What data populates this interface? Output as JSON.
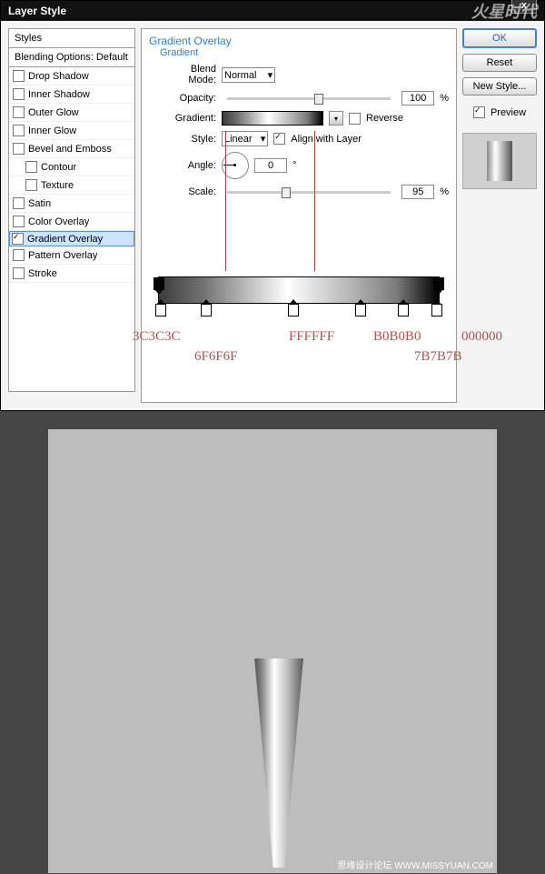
{
  "dialog": {
    "title": "Layer Style"
  },
  "watermark_logo": "火星时代",
  "left": {
    "header": "Styles",
    "blending": "Blending Options: Default",
    "items": [
      {
        "label": "Drop Shadow",
        "checked": false
      },
      {
        "label": "Inner Shadow",
        "checked": false
      },
      {
        "label": "Outer Glow",
        "checked": false
      },
      {
        "label": "Inner Glow",
        "checked": false
      },
      {
        "label": "Bevel and Emboss",
        "checked": false
      },
      {
        "label": "Contour",
        "checked": false,
        "sub": true
      },
      {
        "label": "Texture",
        "checked": false,
        "sub": true
      },
      {
        "label": "Satin",
        "checked": false
      },
      {
        "label": "Color Overlay",
        "checked": false
      },
      {
        "label": "Gradient Overlay",
        "checked": true,
        "selected": true
      },
      {
        "label": "Pattern Overlay",
        "checked": false
      },
      {
        "label": "Stroke",
        "checked": false
      }
    ]
  },
  "mid": {
    "section": "Gradient Overlay",
    "subtitle": "Gradient",
    "blend_label": "Blend Mode:",
    "blend_value": "Normal",
    "opacity_label": "Opacity:",
    "opacity": "100",
    "pct": "%",
    "gradient_label": "Gradient:",
    "reverse": "Reverse",
    "style_label": "Style:",
    "style_value": "Linear",
    "align": "Align with Layer",
    "angle_label": "Angle:",
    "angle": "0",
    "deg": "°",
    "scale_label": "Scale:",
    "scale": "95"
  },
  "right": {
    "ok": "OK",
    "reset": "Reset",
    "newstyle": "New Style...",
    "preview": "Preview"
  },
  "gradient_labels": [
    "3C3C3C",
    "6F6F6F",
    "FFFFFF",
    "B0B0B0",
    "7B7B7B",
    "000000"
  ],
  "canvas_watermark": "思缘设计论坛  WWW.MISSYUAN.COM"
}
